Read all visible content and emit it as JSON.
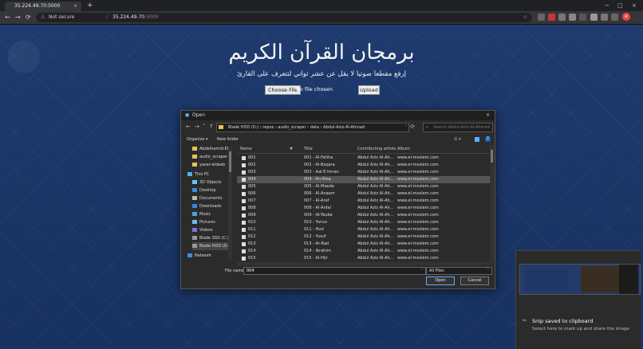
{
  "browser": {
    "tab_title": "35.224.49.70:5000",
    "tab_close": "×",
    "new_tab": "+",
    "nav": {
      "back": "←",
      "forward": "→",
      "reload": "⟳"
    },
    "security": "Not secure",
    "url_host": "35.224.49.70",
    "url_port": ":5000",
    "star": "☆",
    "profile_initial": "e",
    "window_controls": [
      "−",
      "□",
      "×"
    ]
  },
  "page": {
    "title": "برمجان القرآن الكريم",
    "subtitle": "إرفع مقطعا صوتيا لا يقل عن عشر ثواني لتتعرف على القارئ",
    "choose_file_label": "Choose File",
    "no_file_text": "No file chosen",
    "upload_label": "Upload"
  },
  "dialog": {
    "title": "Open",
    "close": "×",
    "breadcrumb": "Blade HDD (D:)  ›  repos  ›  audio_scraper  ›  data  ›  Abdul-Aziz-Al-Ahmad",
    "search_placeholder": "Search Abdul-Aziz-Al-Ahmad",
    "organize": "Organize ▾",
    "new_folder": "New folder",
    "nav_items": [
      {
        "label": "Abdelhamid-Elv",
        "icon": "folder-icon"
      },
      {
        "label": "audio_scraper",
        "icon": "folder-icon"
      },
      {
        "label": "yaser-aldeeb",
        "icon": "folder-icon"
      },
      {
        "label": "This PC",
        "icon": "computer-icon"
      },
      {
        "label": "3D Objects",
        "icon": "folder-icon"
      },
      {
        "label": "Desktop",
        "icon": "desktop-icon"
      },
      {
        "label": "Documents",
        "icon": "documents-icon"
      },
      {
        "label": "Downloads",
        "icon": "downloads-icon"
      },
      {
        "label": "Music",
        "icon": "music-icon"
      },
      {
        "label": "Pictures",
        "icon": "pictures-icon"
      },
      {
        "label": "Videos",
        "icon": "videos-icon"
      },
      {
        "label": "Blade SSD (C:)",
        "icon": "drive-icon"
      },
      {
        "label": "Blade HDD (D:)",
        "icon": "drive-icon"
      },
      {
        "label": "Network",
        "icon": "network-icon"
      }
    ],
    "columns": {
      "name": "Name",
      "num": "#",
      "title": "Title",
      "artists": "Contributing artists",
      "album": "Album"
    },
    "rows": [
      {
        "name": "001",
        "title": "001 - Al-Fatiha",
        "artist": "Abdul Aziz Al-Ah...",
        "album": "www.el-moslem.com"
      },
      {
        "name": "002",
        "title": "002 - Al-Baqara",
        "artist": "Abdul Aziz Al-Ah...",
        "album": "www.el-moslem.com"
      },
      {
        "name": "003",
        "title": "003 - Aal-E-Imran",
        "artist": "Abdul Aziz Al-Ah...",
        "album": "www.el-moslem.com"
      },
      {
        "name": "004",
        "title": "004 - An-Nisa",
        "artist": "Abdul Aziz Al-Ah...",
        "album": "www.el-moslem.com",
        "selected": true
      },
      {
        "name": "005",
        "title": "005 - Al-Maeda",
        "artist": "Abdul Aziz Al-Ah...",
        "album": "www.el-moslem.com"
      },
      {
        "name": "006",
        "title": "006 - Al-Anaam",
        "artist": "Abdul Aziz Al-Ah...",
        "album": "www.el-moslem.com"
      },
      {
        "name": "007",
        "title": "007 - Al-Araf",
        "artist": "Abdul Aziz Al-Ah...",
        "album": "www.el-moslem.com"
      },
      {
        "name": "008",
        "title": "008 - Al-Anfal",
        "artist": "Abdul Aziz Al-Ah...",
        "album": "www.el-moslem.com"
      },
      {
        "name": "009",
        "title": "009 - At-Taube",
        "artist": "Abdul Aziz Al-Ah...",
        "album": "www.el-moslem.com"
      },
      {
        "name": "010",
        "title": "010 - Yunus",
        "artist": "Abdul Aziz Al-Ah...",
        "album": "www.el-moslem.com"
      },
      {
        "name": "011",
        "title": "011 - Hud",
        "artist": "Abdul Aziz Al-Ah...",
        "album": "www.el-moslem.com"
      },
      {
        "name": "012",
        "title": "012 - Yusuf",
        "artist": "Abdul Aziz Al-Ah...",
        "album": "www.el-moslem.com"
      },
      {
        "name": "013",
        "title": "013 - Ar-Rad",
        "artist": "Abdul Aziz Al-Ah...",
        "album": "www.el-moslem.com"
      },
      {
        "name": "014",
        "title": "014 - Ibrahim",
        "artist": "Abdul Aziz Al-Ah...",
        "album": "www.el-moslem.com"
      },
      {
        "name": "015",
        "title": "015 - Al-Hijr",
        "artist": "Abdul Aziz Al-Ah...",
        "album": "www.el-moslem.com"
      }
    ],
    "file_name_label": "File name:",
    "file_name_value": "004",
    "file_type": "All Files",
    "open_label": "Open",
    "cancel_label": "Cancel"
  },
  "toast": {
    "heading": "Snip saved to clipboard",
    "body": "Select here to mark up and share the image"
  },
  "colors": {
    "page_bg": "#1b3567",
    "chrome": "#35363a",
    "dialog_bg": "#2b2b2b",
    "accent": "#5ab0ff"
  }
}
